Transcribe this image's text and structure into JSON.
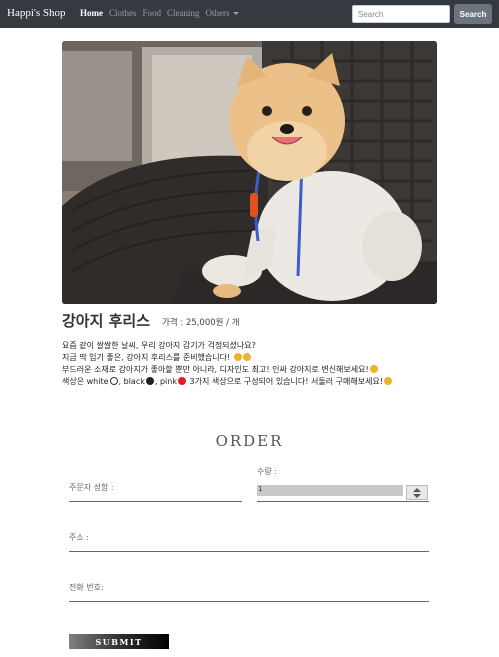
{
  "navbar": {
    "brand": "Happi's Shop",
    "items": [
      {
        "label": "Home"
      },
      {
        "label": "Clothes"
      },
      {
        "label": "Food"
      },
      {
        "label": "Cleaning"
      },
      {
        "label": "Others"
      }
    ],
    "search_placeholder": "Search",
    "search_button": "Search"
  },
  "product": {
    "image_icon": "dog-photo",
    "name": "강아지 후리스",
    "price": "가격 : 25,000원 / 개",
    "description": {
      "line1": "요즘 같이 쌀쌀한 날씨, 우리 강아지 감기가 걱정되셨나요?",
      "line2": "지금 딱 입기 좋은, 강아지 후리스를 준비했습니다!",
      "line3": "부드러운 소재로 강아지가 좋아할 뿐만 아니라, 디자인도 최고! 인싸 강아지로 변신해보세요!",
      "line4_a": "색상은 white",
      "line4_b": ", black",
      "line4_c": ", pink",
      "line4_d": " 3가지 색상으로 구성되어 있습니다! 서둘러 구매해보세요!"
    }
  },
  "order": {
    "title": "ORDER",
    "name_label": "주문자 성함 :",
    "quantity_label": "수량 :",
    "quantity_value": "1",
    "address_label": "주소 :",
    "phone_label": "전화 번호:",
    "submit_label": "SUBMIT"
  },
  "colors": {
    "navbar_bg": "#343a40",
    "search_button_bg": "#6c757d",
    "white": "#ffffff",
    "black": "#222222",
    "pink": "#e02020"
  }
}
